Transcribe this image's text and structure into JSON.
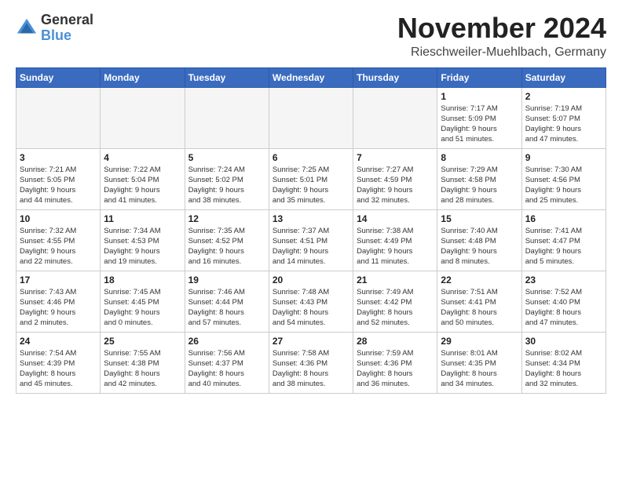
{
  "header": {
    "logo_general": "General",
    "logo_blue": "Blue",
    "month_title": "November 2024",
    "location": "Rieschweiler-Muehlbach, Germany"
  },
  "weekdays": [
    "Sunday",
    "Monday",
    "Tuesday",
    "Wednesday",
    "Thursday",
    "Friday",
    "Saturday"
  ],
  "weeks": [
    [
      {
        "day": "",
        "text": "",
        "empty": true
      },
      {
        "day": "",
        "text": "",
        "empty": true
      },
      {
        "day": "",
        "text": "",
        "empty": true
      },
      {
        "day": "",
        "text": "",
        "empty": true
      },
      {
        "day": "",
        "text": "",
        "empty": true
      },
      {
        "day": "1",
        "text": "Sunrise: 7:17 AM\nSunset: 5:09 PM\nDaylight: 9 hours\nand 51 minutes."
      },
      {
        "day": "2",
        "text": "Sunrise: 7:19 AM\nSunset: 5:07 PM\nDaylight: 9 hours\nand 47 minutes."
      }
    ],
    [
      {
        "day": "3",
        "text": "Sunrise: 7:21 AM\nSunset: 5:05 PM\nDaylight: 9 hours\nand 44 minutes."
      },
      {
        "day": "4",
        "text": "Sunrise: 7:22 AM\nSunset: 5:04 PM\nDaylight: 9 hours\nand 41 minutes."
      },
      {
        "day": "5",
        "text": "Sunrise: 7:24 AM\nSunset: 5:02 PM\nDaylight: 9 hours\nand 38 minutes."
      },
      {
        "day": "6",
        "text": "Sunrise: 7:25 AM\nSunset: 5:01 PM\nDaylight: 9 hours\nand 35 minutes."
      },
      {
        "day": "7",
        "text": "Sunrise: 7:27 AM\nSunset: 4:59 PM\nDaylight: 9 hours\nand 32 minutes."
      },
      {
        "day": "8",
        "text": "Sunrise: 7:29 AM\nSunset: 4:58 PM\nDaylight: 9 hours\nand 28 minutes."
      },
      {
        "day": "9",
        "text": "Sunrise: 7:30 AM\nSunset: 4:56 PM\nDaylight: 9 hours\nand 25 minutes."
      }
    ],
    [
      {
        "day": "10",
        "text": "Sunrise: 7:32 AM\nSunset: 4:55 PM\nDaylight: 9 hours\nand 22 minutes."
      },
      {
        "day": "11",
        "text": "Sunrise: 7:34 AM\nSunset: 4:53 PM\nDaylight: 9 hours\nand 19 minutes."
      },
      {
        "day": "12",
        "text": "Sunrise: 7:35 AM\nSunset: 4:52 PM\nDaylight: 9 hours\nand 16 minutes."
      },
      {
        "day": "13",
        "text": "Sunrise: 7:37 AM\nSunset: 4:51 PM\nDaylight: 9 hours\nand 14 minutes."
      },
      {
        "day": "14",
        "text": "Sunrise: 7:38 AM\nSunset: 4:49 PM\nDaylight: 9 hours\nand 11 minutes."
      },
      {
        "day": "15",
        "text": "Sunrise: 7:40 AM\nSunset: 4:48 PM\nDaylight: 9 hours\nand 8 minutes."
      },
      {
        "day": "16",
        "text": "Sunrise: 7:41 AM\nSunset: 4:47 PM\nDaylight: 9 hours\nand 5 minutes."
      }
    ],
    [
      {
        "day": "17",
        "text": "Sunrise: 7:43 AM\nSunset: 4:46 PM\nDaylight: 9 hours\nand 2 minutes."
      },
      {
        "day": "18",
        "text": "Sunrise: 7:45 AM\nSunset: 4:45 PM\nDaylight: 9 hours\nand 0 minutes."
      },
      {
        "day": "19",
        "text": "Sunrise: 7:46 AM\nSunset: 4:44 PM\nDaylight: 8 hours\nand 57 minutes."
      },
      {
        "day": "20",
        "text": "Sunrise: 7:48 AM\nSunset: 4:43 PM\nDaylight: 8 hours\nand 54 minutes."
      },
      {
        "day": "21",
        "text": "Sunrise: 7:49 AM\nSunset: 4:42 PM\nDaylight: 8 hours\nand 52 minutes."
      },
      {
        "day": "22",
        "text": "Sunrise: 7:51 AM\nSunset: 4:41 PM\nDaylight: 8 hours\nand 50 minutes."
      },
      {
        "day": "23",
        "text": "Sunrise: 7:52 AM\nSunset: 4:40 PM\nDaylight: 8 hours\nand 47 minutes."
      }
    ],
    [
      {
        "day": "24",
        "text": "Sunrise: 7:54 AM\nSunset: 4:39 PM\nDaylight: 8 hours\nand 45 minutes."
      },
      {
        "day": "25",
        "text": "Sunrise: 7:55 AM\nSunset: 4:38 PM\nDaylight: 8 hours\nand 42 minutes."
      },
      {
        "day": "26",
        "text": "Sunrise: 7:56 AM\nSunset: 4:37 PM\nDaylight: 8 hours\nand 40 minutes."
      },
      {
        "day": "27",
        "text": "Sunrise: 7:58 AM\nSunset: 4:36 PM\nDaylight: 8 hours\nand 38 minutes."
      },
      {
        "day": "28",
        "text": "Sunrise: 7:59 AM\nSunset: 4:36 PM\nDaylight: 8 hours\nand 36 minutes."
      },
      {
        "day": "29",
        "text": "Sunrise: 8:01 AM\nSunset: 4:35 PM\nDaylight: 8 hours\nand 34 minutes."
      },
      {
        "day": "30",
        "text": "Sunrise: 8:02 AM\nSunset: 4:34 PM\nDaylight: 8 hours\nand 32 minutes."
      }
    ]
  ]
}
